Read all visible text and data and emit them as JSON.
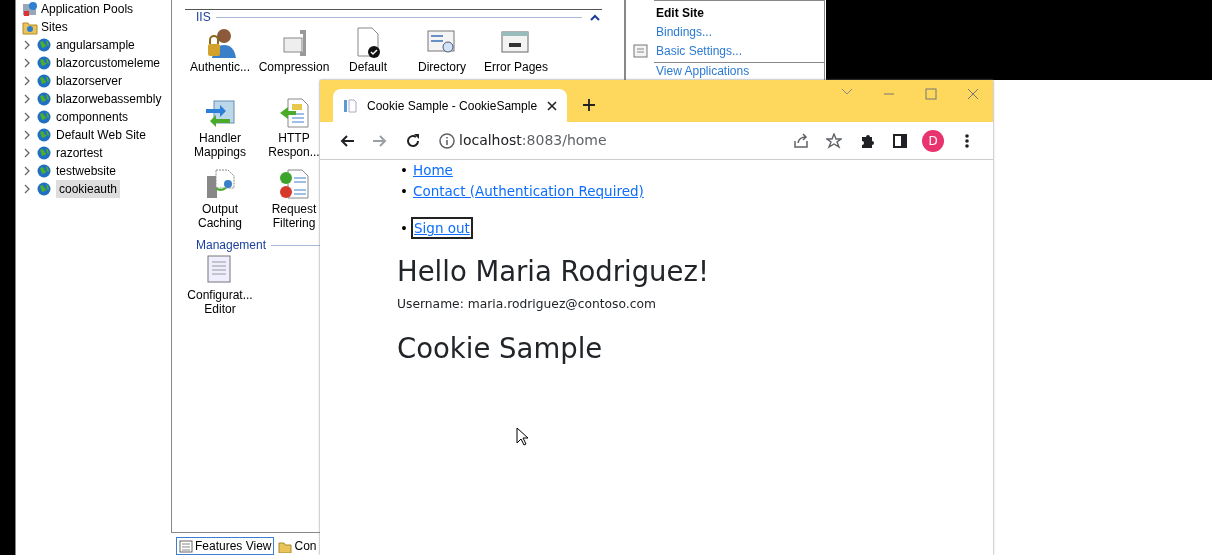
{
  "tree": {
    "items": [
      {
        "label": "Application Pools",
        "kind": "pools"
      },
      {
        "label": "Sites",
        "kind": "sites",
        "children": [
          {
            "label": "angularsample",
            "selected": false
          },
          {
            "label": "blazorcustomeleme",
            "selected": false
          },
          {
            "label": "blazorserver",
            "selected": false
          },
          {
            "label": "blazorwebassembly",
            "selected": false
          },
          {
            "label": "componnents",
            "selected": false
          },
          {
            "label": "Default Web Site",
            "selected": false
          },
          {
            "label": "razortest",
            "selected": false
          },
          {
            "label": "testwebsite",
            "selected": false
          },
          {
            "label": "cookieauth",
            "selected": true
          }
        ]
      }
    ]
  },
  "features": {
    "groups": [
      {
        "title": "IIS",
        "rows": [
          [
            {
              "label": "Authentic...",
              "kind": "auth"
            },
            {
              "label": "Compression",
              "kind": "compress"
            },
            {
              "label": "Default",
              "kind": "doc"
            },
            {
              "label": "Directory",
              "kind": "dir"
            },
            {
              "label": "Error Pages",
              "kind": "error"
            }
          ],
          [
            {
              "label": "Handler Mappings",
              "kind": "handler"
            },
            {
              "label": "HTTP Respon...",
              "kind": "http"
            }
          ],
          [
            {
              "label": "Output Caching",
              "kind": "cache"
            },
            {
              "label": "Request Filtering",
              "kind": "filter"
            }
          ]
        ]
      },
      {
        "title": "Management",
        "rows": [
          [
            {
              "label": "Configurat... Editor",
              "kind": "config"
            }
          ]
        ]
      }
    ]
  },
  "actions": {
    "heading": "Edit Site",
    "links": [
      {
        "label": "Bindings..."
      },
      {
        "label": "Basic Settings...",
        "kind": "settings"
      }
    ],
    "more": [
      {
        "label": "View Applications"
      }
    ]
  },
  "bottom_tabs": [
    {
      "label": "Features View",
      "selected": true
    },
    {
      "label": "Con",
      "selected": false
    }
  ],
  "browser": {
    "tab_title": "Cookie Sample - CookieSample",
    "url_host": "localhost",
    "url_rest": ":8083/home",
    "profile": "D",
    "toolbar": [
      {
        "kind": "back",
        "disabled": false
      },
      {
        "kind": "forward",
        "disabled": true
      },
      {
        "kind": "reload",
        "disabled": false
      }
    ],
    "nav": [
      {
        "marker": "•",
        "label": "Home",
        "focused": false
      },
      {
        "marker": "•",
        "label": "Contact (Authentication Required)",
        "focused": false
      },
      {
        "marker": "•",
        "label": "Sign out",
        "focused": true
      }
    ],
    "heading": "Hello Maria Rodriguez!",
    "username": "Username: maria.rodriguez@contoso.com",
    "title": "Cookie Sample"
  }
}
